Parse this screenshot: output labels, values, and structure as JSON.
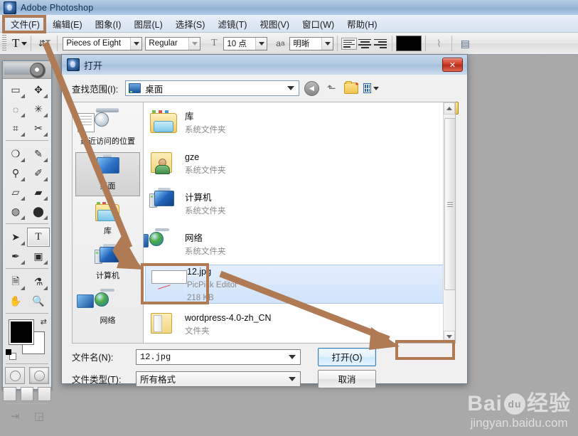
{
  "app": {
    "title": "Adobe Photoshop",
    "icon": "photoshop-icon",
    "menus": [
      {
        "label": "文件(F)",
        "highlighted": true
      },
      {
        "label": "编辑(E)"
      },
      {
        "label": "图象(I)"
      },
      {
        "label": "图层(L)"
      },
      {
        "label": "选择(S)"
      },
      {
        "label": "滤镜(T)"
      },
      {
        "label": "视图(V)"
      },
      {
        "label": "窗口(W)"
      },
      {
        "label": "帮助(H)"
      }
    ]
  },
  "options_bar": {
    "tool_icon": "type-tool-icon",
    "orientation_icon": "text-orientation-icon",
    "font_family": "Pieces of Eight",
    "font_style": "Regular",
    "size_icon": "font-size-icon",
    "font_size": "10 点",
    "antialias_icon": "anti-aliasing-icon",
    "antialias": "明晰",
    "align_left_icon": "align-left-icon",
    "align_center_icon": "align-center-icon",
    "align_right_icon": "align-right-icon",
    "color_swatch": "#000000",
    "warp_icon": "warp-text-icon",
    "palette_icon": "toggle-palettes-icon"
  },
  "toolbox": {
    "tools": [
      {
        "name": "marquee-tool",
        "glyph": "▭"
      },
      {
        "name": "move-tool",
        "glyph": "✥"
      },
      {
        "name": "lasso-tool",
        "glyph": "◯"
      },
      {
        "name": "magic-wand-tool",
        "glyph": "✳"
      },
      {
        "name": "crop-tool",
        "glyph": "⌗"
      },
      {
        "name": "slice-tool",
        "glyph": "✂"
      },
      {
        "name": "healing-brush-tool",
        "glyph": "🩹"
      },
      {
        "name": "brush-tool",
        "glyph": "✎"
      },
      {
        "name": "clone-stamp-tool",
        "glyph": "⚲"
      },
      {
        "name": "history-brush-tool",
        "glyph": "✐"
      },
      {
        "name": "eraser-tool",
        "glyph": "▱"
      },
      {
        "name": "gradient-tool",
        "glyph": "▬"
      },
      {
        "name": "blur-tool",
        "glyph": "💧"
      },
      {
        "name": "dodge-tool",
        "glyph": "⬤"
      },
      {
        "name": "path-selection-tool",
        "glyph": "➤"
      },
      {
        "name": "type-tool",
        "glyph": "T",
        "selected": true
      },
      {
        "name": "pen-tool",
        "glyph": "✒"
      },
      {
        "name": "shape-tool",
        "glyph": "▣"
      },
      {
        "name": "notes-tool",
        "glyph": "🗎"
      },
      {
        "name": "eyedropper-tool",
        "glyph": "⚗"
      },
      {
        "name": "hand-tool",
        "glyph": "✋"
      },
      {
        "name": "zoom-tool",
        "glyph": "🔍"
      }
    ],
    "foreground_color": "#000000",
    "background_color": "#ffffff",
    "quickmask_standard": "standard-mode-icon",
    "quickmask_mask": "quick-mask-mode-icon",
    "screen_modes": [
      "standard-screen-mode",
      "full-screen-menubar-mode",
      "full-screen-mode"
    ],
    "jump_to_imageready": "jump-to-imageready-icon"
  },
  "dialog": {
    "title": "打开",
    "icon": "photoshop-icon",
    "close_label": "✕",
    "lookin_label": "查找范围(I):",
    "lookin_value": "桌面",
    "lookin_icon": "desktop-icon",
    "toolbar": [
      {
        "name": "back-button",
        "glyph": "◀"
      },
      {
        "name": "up-one-level-button",
        "glyph": "⬆"
      },
      {
        "name": "new-folder-button",
        "glyph": "📁"
      },
      {
        "name": "views-button",
        "glyph": "▦"
      }
    ],
    "right_folder_icon": "open-folder-icon",
    "places": [
      {
        "label": "最近访问的位置",
        "icon": "recent-places-icon",
        "selected": false
      },
      {
        "label": "桌面",
        "icon": "desktop-icon",
        "selected": true
      },
      {
        "label": "库",
        "icon": "libraries-icon",
        "selected": false
      },
      {
        "label": "计算机",
        "icon": "computer-icon",
        "selected": false
      },
      {
        "label": "网络",
        "icon": "network-icon",
        "selected": false
      }
    ],
    "files": [
      {
        "name": "库",
        "sub": "系统文件夹",
        "icon": "libraries-folder-icon",
        "selected": false
      },
      {
        "name": "gze",
        "sub": "系统文件夹",
        "icon": "user-folder-icon",
        "selected": false
      },
      {
        "name": "计算机",
        "sub": "系统文件夹",
        "icon": "computer-icon",
        "selected": false
      },
      {
        "name": "网络",
        "sub": "系统文件夹",
        "icon": "network-icon",
        "selected": false
      },
      {
        "name": "12.jpg",
        "sub": "PicPick Editor",
        "sub2": "218 KB",
        "icon": "image-thumbnail-icon",
        "selected": true
      },
      {
        "name": "wordpress-4.0-zh_CN",
        "sub": "文件夹",
        "icon": "folder-icon",
        "selected": false
      }
    ],
    "filename_label": "文件名(N):",
    "filename_value": "12.jpg",
    "filetype_label": "文件类型(T):",
    "filetype_value": "所有格式",
    "open_button": "打开(O)",
    "cancel_button": "取消"
  },
  "annotations": {
    "box_color": "#b07a55",
    "boxes": [
      "file-menu-highlight",
      "selected-file-highlight",
      "open-button-highlight"
    ],
    "arrows": [
      "arrow-file-menu-to-file",
      "arrow-file-to-open-button"
    ]
  },
  "watermark": {
    "brand": "Bai",
    "brand2": "经验",
    "paw": "du",
    "url": "jingyan.baidu.com"
  }
}
